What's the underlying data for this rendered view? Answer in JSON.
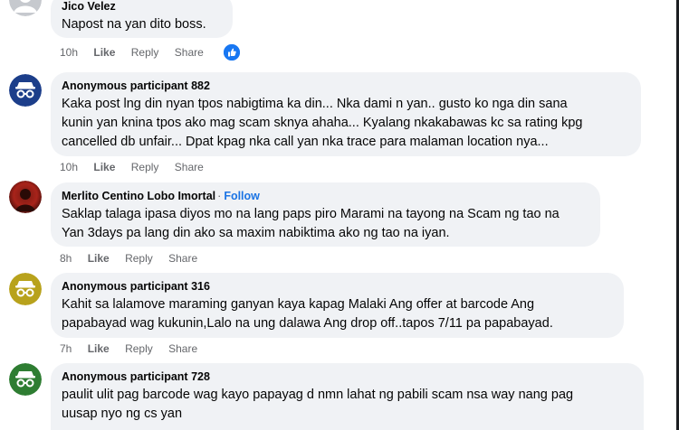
{
  "comments": [
    {
      "name": "Jico Velez",
      "text_lines": [
        "Napost na yan dito boss."
      ],
      "time": "10h",
      "like": "Like",
      "reply": "Reply",
      "share": "Share",
      "avatar": "default-profile-avatar",
      "reaction": "like-reaction-icon"
    },
    {
      "name": "Anonymous participant 882",
      "text_lines": [
        "Kaka post lng din nyan tpos nabigtima ka din... Nka dami n yan.. gusto ko nga din sana",
        "kunin yan knina tpos ako mag scam sknya ahaha... Kyalang nkakabawas kc sa rating kpg",
        "cancelled db unfair... Dpat kpag nka call yan nka trace para malaman location nya..."
      ],
      "time": "10h",
      "like": "Like",
      "reply": "Reply",
      "share": "Share",
      "avatar": "anonymous-avatar",
      "avatar_color": "#1c3e8a"
    },
    {
      "name": "Merlito Centino Lobo Imortal",
      "separator": "·",
      "follow": "Follow",
      "text_lines": [
        "Saklap talaga ipasa diyos mo na lang paps piro Marami na tayong na Scam ng tao na",
        "Yan 3days pa lang din ako sa maxim nabiktima ako ng tao na iyan."
      ],
      "time": "8h",
      "like": "Like",
      "reply": "Reply",
      "share": "Share",
      "avatar": "profile-photo-avatar"
    },
    {
      "name": "Anonymous participant 316",
      "text_lines": [
        "Kahit sa lalamove maraming ganyan kaya kapag Malaki Ang offer at barcode Ang",
        "papabayad wag kukunin,Lalo na ung dalawa Ang drop off..tapos 7/11 pa papabayad."
      ],
      "time": "7h",
      "like": "Like",
      "reply": "Reply",
      "share": "Share",
      "avatar": "anonymous-avatar",
      "avatar_color": "#b8a21c"
    },
    {
      "name": "Anonymous participant 728",
      "text_lines": [
        "paulit ulit pag barcode wag kayo papayag d nmn lahat ng pabili scam nsa way nang pag",
        "uusap nyo ng cs yan"
      ]
    }
  ]
}
